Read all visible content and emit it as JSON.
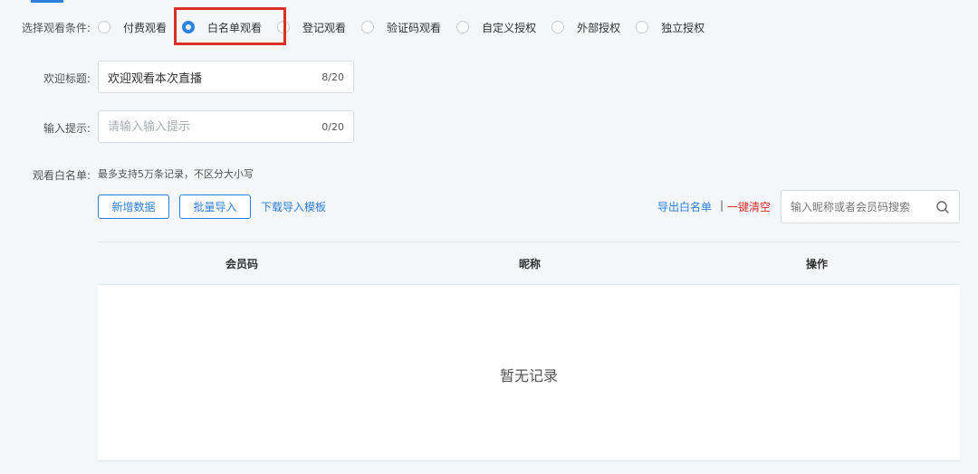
{
  "colors": {
    "primary": "#2d7fe0",
    "danger": "#d9302a",
    "highlight": "#d9302a"
  },
  "watch_condition": {
    "label": "选择观看条件:",
    "options": [
      {
        "label": "付费观看",
        "checked": false
      },
      {
        "label": "白名单观看",
        "checked": true
      },
      {
        "label": "登记观看",
        "checked": false
      },
      {
        "label": "验证码观看",
        "checked": false
      },
      {
        "label": "自定义授权",
        "checked": false
      },
      {
        "label": "外部授权",
        "checked": false
      },
      {
        "label": "独立授权",
        "checked": false
      }
    ]
  },
  "welcome_title": {
    "label": "欢迎标题:",
    "value": "欢迎观看本次直播",
    "placeholder": "",
    "counter": "8/20"
  },
  "input_hint": {
    "label": "输入提示:",
    "value": "",
    "placeholder": "请输入输入提示",
    "counter": "0/20"
  },
  "whitelist": {
    "label": "观看白名单:",
    "hint": "最多支持5万条记录，不区分大小写",
    "add_button": "新增数据",
    "import_button": "批量导入",
    "template_link": "下载导入模板",
    "export_link": "导出白名单",
    "separator": "|",
    "clear_link": "一键清空",
    "search_placeholder": "输入昵称或者会员码搜索",
    "search_icon": "search-icon"
  },
  "table": {
    "columns": [
      "会员码",
      "昵称",
      "操作"
    ],
    "rows": [],
    "empty_text": "暂无记录"
  }
}
